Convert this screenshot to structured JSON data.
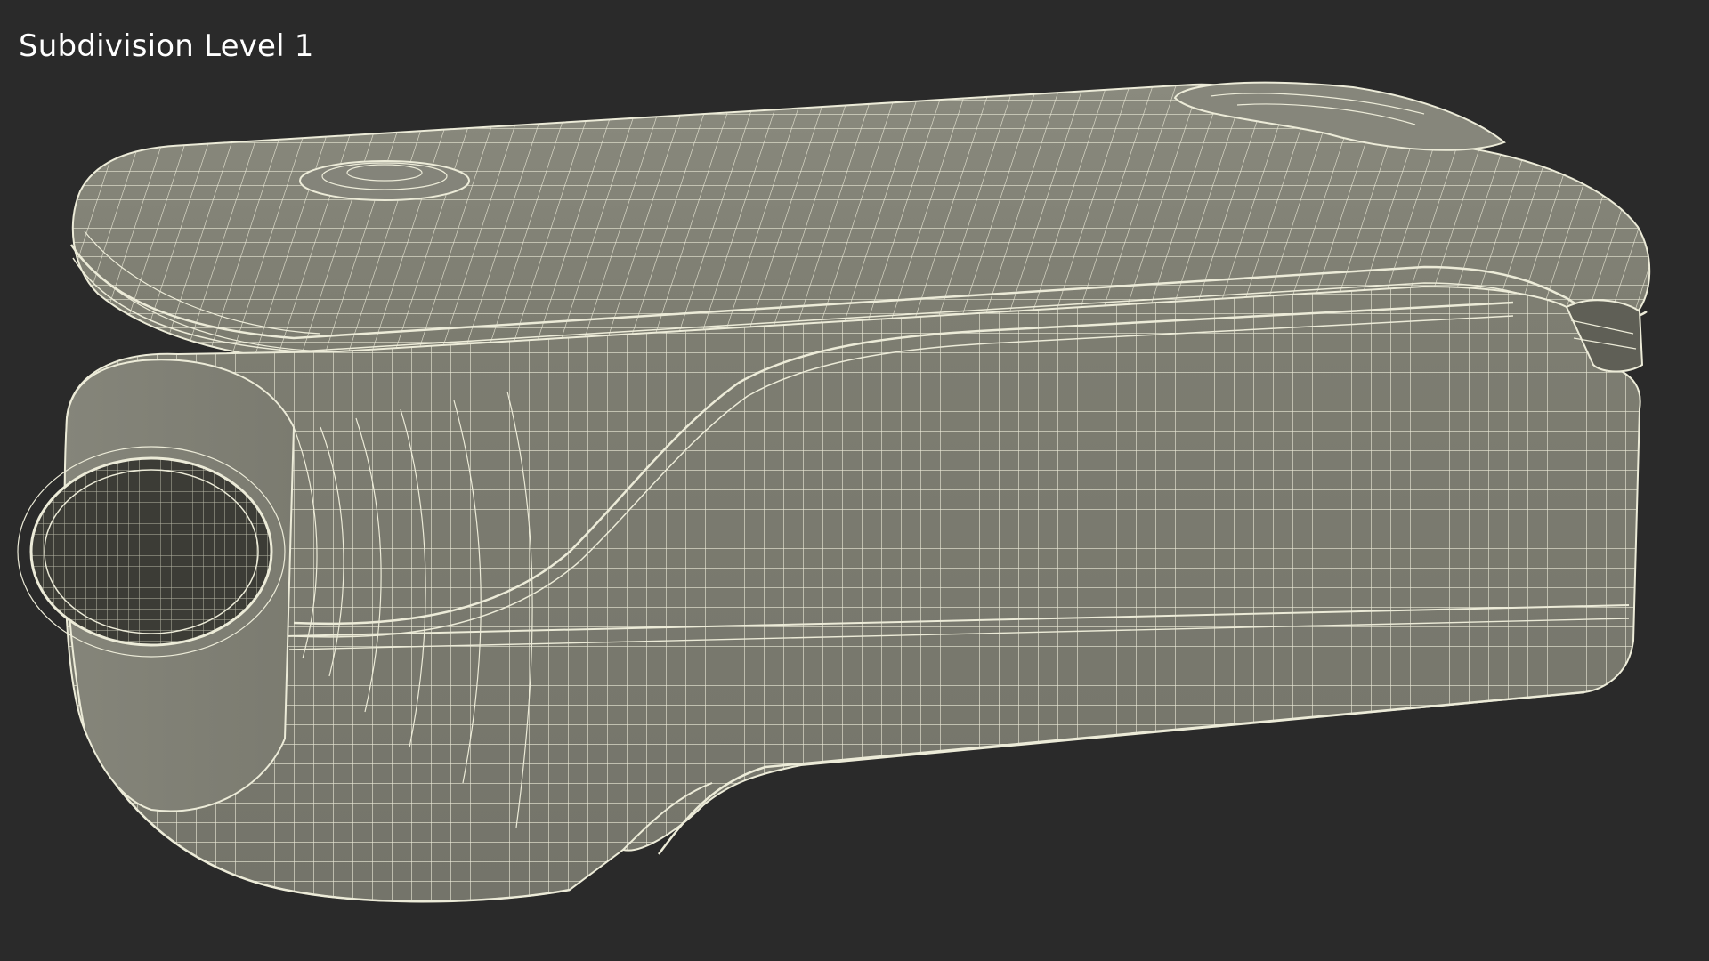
{
  "viewport": {
    "label": "Subdivision Level 1",
    "background": "#2a2a2a"
  },
  "model": {
    "description_visible": false,
    "render_style": "wireframe-over-shaded",
    "surface_color": "#7c7c70",
    "wire_color": "#ecebd8"
  }
}
